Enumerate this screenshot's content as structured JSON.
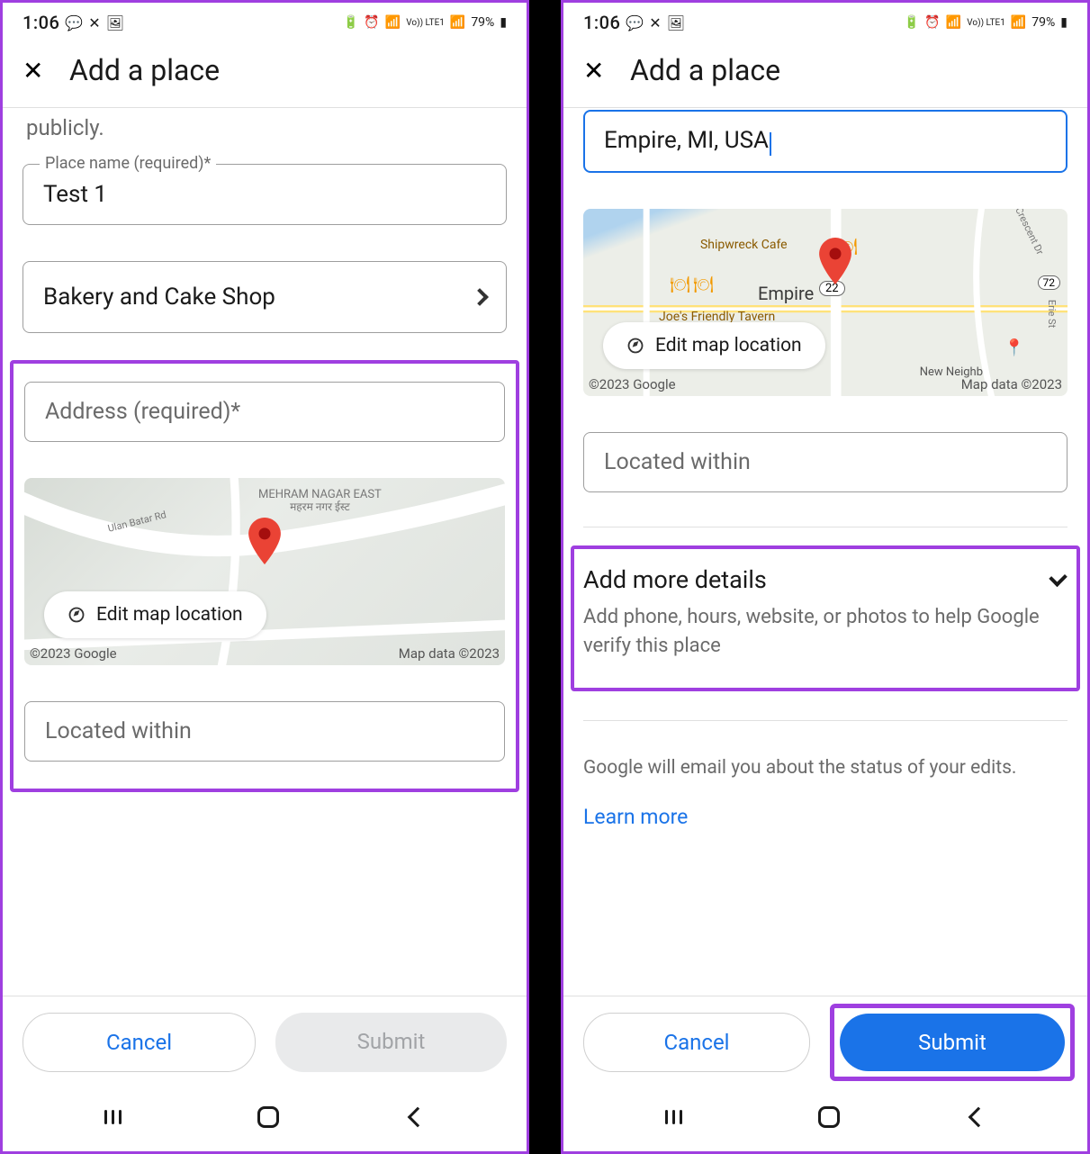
{
  "status": {
    "time": "1:06",
    "battery_pct": "79%",
    "network_label": "Vo)) LTE1"
  },
  "header": {
    "title": "Add a place"
  },
  "left": {
    "truncated_text": "publicly.",
    "place_name": {
      "label": "Place name (required)*",
      "value": "Test 1"
    },
    "category": {
      "value": "Bakery and Cake Shop"
    },
    "address": {
      "placeholder": "Address (required)*"
    },
    "map": {
      "edit_label": "Edit map location",
      "copyright": "©2023 Google",
      "data_attr": "Map data ©2023",
      "area_label_1": "MEHRAM NAGAR EAST",
      "area_label_2": "महरम नगर ईस्ट",
      "road_label": "Ulan Batar Rd"
    },
    "located_within_placeholder": "Located within",
    "footer": {
      "cancel": "Cancel",
      "submit": "Submit"
    }
  },
  "right": {
    "address_value": "Empire, MI, USA",
    "map": {
      "edit_label": "Edit map location",
      "copyright": "©2023 Google",
      "data_attr": "Map data ©2023",
      "poi_1": "Shipwreck Cafe",
      "poi_2": "Joe's Friendly Tavern",
      "town": "Empire",
      "route_badge": "22",
      "neigh": "New Neighb",
      "roads": [
        "Crescent Dr",
        "Erie St"
      ],
      "route_east": "72"
    },
    "located_within_placeholder": "Located within",
    "expander": {
      "title": "Add more details",
      "subtitle": "Add phone, hours, website, or photos to help Google verify this place"
    },
    "info_text": "Google will email you about the status of your edits.",
    "learn_more": "Learn more",
    "footer": {
      "cancel": "Cancel",
      "submit": "Submit"
    }
  }
}
